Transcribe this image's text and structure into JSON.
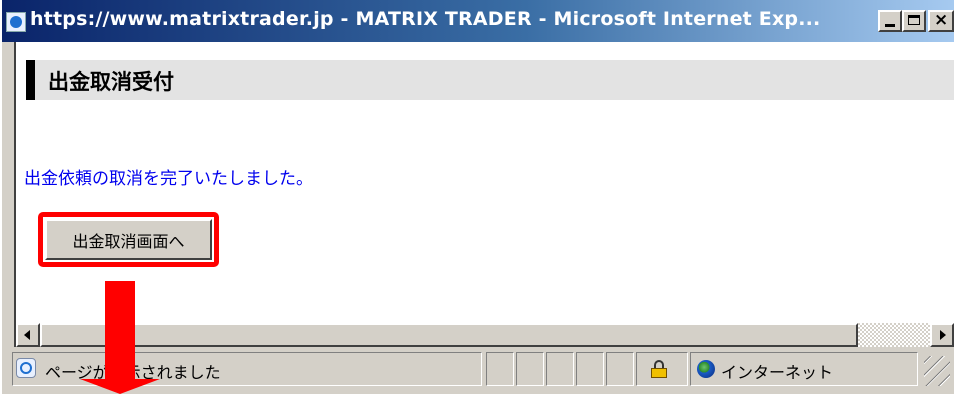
{
  "window": {
    "title": "https://www.matrixtrader.jp - MATRIX TRADER - Microsoft Internet Exp..."
  },
  "page": {
    "title": "出金取消受付",
    "message": "出金依頼の取消を完了いたしました。",
    "button_label": "出金取消画面へ"
  },
  "statusbar": {
    "status_text": "ページが表示されました",
    "zone_text": "インターネット"
  },
  "colors": {
    "highlight": "#ff0000",
    "message_text": "#0000ee",
    "title_bar": "#0a246a"
  },
  "icons": {
    "title": "ie-page-icon",
    "status": "ie-page-icon",
    "security": "lock-icon",
    "zone": "globe-icon",
    "annotation": "red-down-arrow"
  }
}
